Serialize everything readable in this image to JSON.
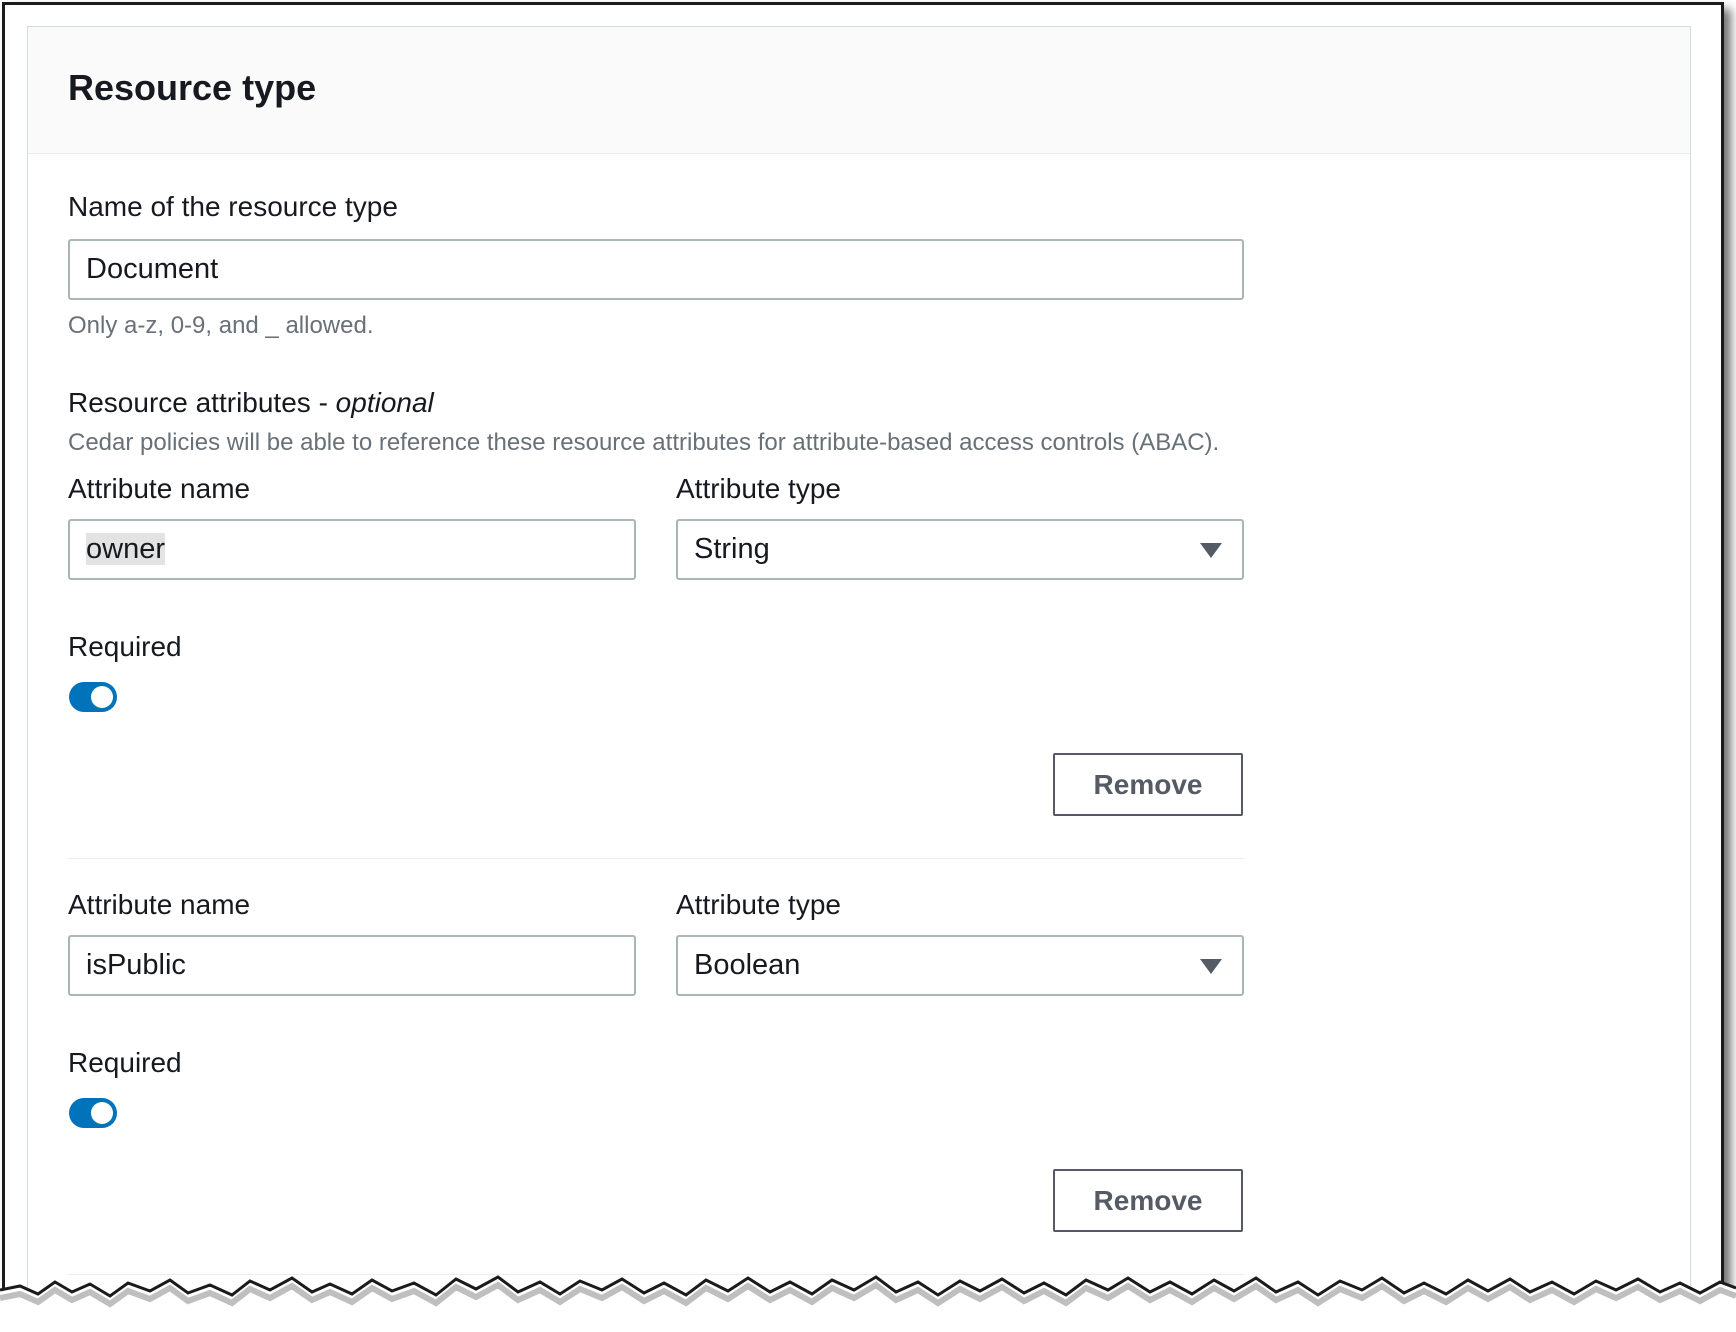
{
  "panel": {
    "title": "Resource type"
  },
  "resource_name": {
    "label": "Name of the resource type",
    "value": "Document",
    "hint": "Only a-z, 0-9, and _ allowed."
  },
  "attributes_section": {
    "label": "Resource attributes - ",
    "label_optional": "optional",
    "description": "Cedar policies will be able to reference these resource attributes for attribute-based access controls (ABAC)."
  },
  "attributes": [
    {
      "name_label": "Attribute name",
      "name_value": "owner",
      "type_label": "Attribute type",
      "type_value": "String",
      "required_label": "Required",
      "required": true,
      "remove_label": "Remove"
    },
    {
      "name_label": "Attribute name",
      "name_value": "isPublic",
      "type_label": "Attribute type",
      "type_value": "Boolean",
      "required_label": "Required",
      "required": true,
      "remove_label": "Remove"
    }
  ],
  "icons": {
    "dropdown": "caret-down-icon"
  },
  "colors": {
    "toggle_on": "#0073bb",
    "text": "#16191f",
    "hint": "#687078",
    "button_text": "#545b64"
  }
}
